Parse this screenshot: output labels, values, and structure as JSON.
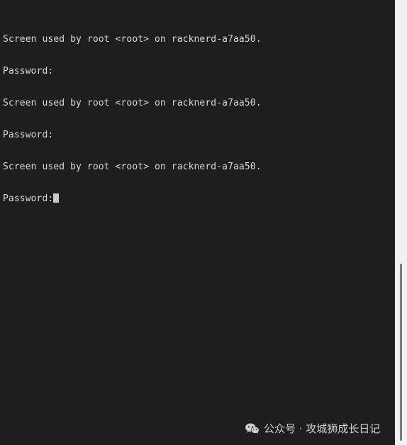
{
  "terminal": {
    "lines": [
      "Screen used by root <root> on racknerd-a7aa50.",
      "Password:",
      "Screen used by root <root> on racknerd-a7aa50.",
      "Password:",
      "Screen used by root <root> on racknerd-a7aa50.",
      "Password:"
    ]
  },
  "watermark": {
    "text": "公众号 · 攻城狮成长日记",
    "icon": "wechat-icon"
  },
  "colors": {
    "background": "#1e1e1e",
    "text": "#d8d8d8",
    "cursor": "#c8c8c8",
    "scrollbar_track": "#f0f0f0",
    "scrollbar_thumb": "#7a7a7a"
  }
}
